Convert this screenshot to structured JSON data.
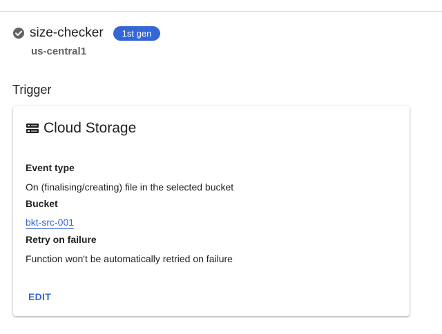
{
  "function": {
    "name": "size-checker",
    "generation_badge": "1st gen",
    "region": "us-central1",
    "status_icon": "check-circle-icon",
    "status_color": "#5f6368"
  },
  "trigger": {
    "section_title": "Trigger",
    "card": {
      "icon": "storage-icon",
      "title": "Cloud Storage",
      "event_type_label": "Event type",
      "event_type_value": "On (finalising/creating) file in the selected bucket",
      "bucket_label": "Bucket",
      "bucket_value": "bkt-src-001",
      "retry_label": "Retry on failure",
      "retry_value": "Function won't be automatically retried on failure",
      "edit_label": "EDIT"
    }
  },
  "colors": {
    "accent": "#3367d6",
    "text": "#202124",
    "muted": "#5f6368"
  }
}
